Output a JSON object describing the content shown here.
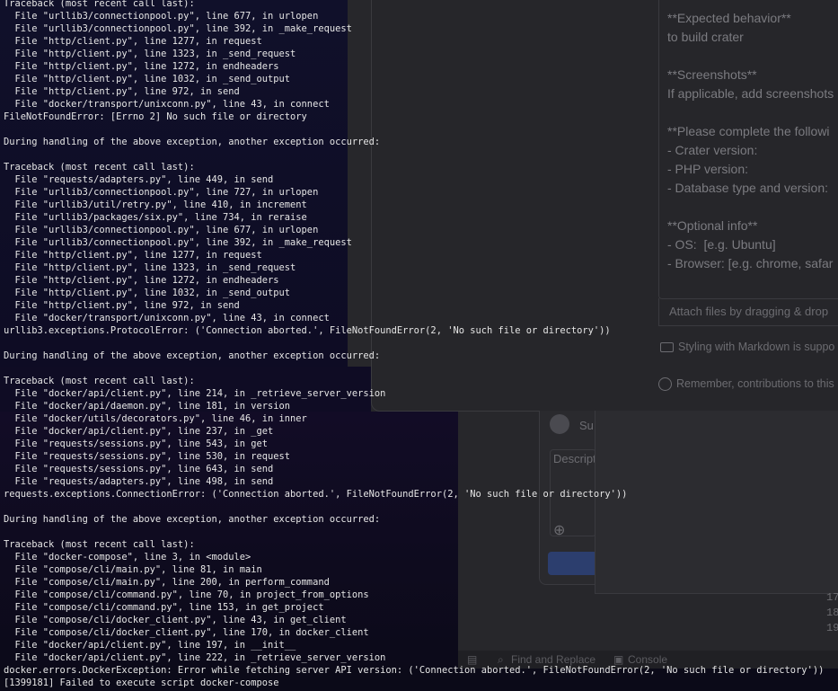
{
  "background": {
    "issue_body_lines": [
      "**Expected behavior**",
      "to build crater",
      "",
      "**Screenshots**",
      "If applicable, add screenshots",
      "",
      "**Please complete the followi",
      "- Crater version:",
      "- PHP version:",
      "- Database type and version:",
      "",
      "**Optional info**",
      "- OS:  [e.g. Ubuntu]",
      "- Browser: [e.g. chrome, safar"
    ],
    "attach_text": "Attach files by dragging & drop",
    "markdown_hint": "Styling with Markdown is suppo",
    "remember_text": "Remember, contributions to this",
    "card_text_1": "Su",
    "card_text_2": "Descript",
    "line_numbers": [
      "17",
      "18",
      "19"
    ],
    "devtools": {
      "find_replace": "Find and Replace",
      "console": "Console"
    }
  },
  "terminal": {
    "lines": [
      "Traceback (most recent call last):",
      "  File \"urllib3/connectionpool.py\", line 677, in urlopen",
      "  File \"urllib3/connectionpool.py\", line 392, in _make_request",
      "  File \"http/client.py\", line 1277, in request",
      "  File \"http/client.py\", line 1323, in _send_request",
      "  File \"http/client.py\", line 1272, in endheaders",
      "  File \"http/client.py\", line 1032, in _send_output",
      "  File \"http/client.py\", line 972, in send",
      "  File \"docker/transport/unixconn.py\", line 43, in connect",
      "FileNotFoundError: [Errno 2] No such file or directory",
      "",
      "During handling of the above exception, another exception occurred:",
      "",
      "Traceback (most recent call last):",
      "  File \"requests/adapters.py\", line 449, in send",
      "  File \"urllib3/connectionpool.py\", line 727, in urlopen",
      "  File \"urllib3/util/retry.py\", line 410, in increment",
      "  File \"urllib3/packages/six.py\", line 734, in reraise",
      "  File \"urllib3/connectionpool.py\", line 677, in urlopen",
      "  File \"urllib3/connectionpool.py\", line 392, in _make_request",
      "  File \"http/client.py\", line 1277, in request",
      "  File \"http/client.py\", line 1323, in _send_request",
      "  File \"http/client.py\", line 1272, in endheaders",
      "  File \"http/client.py\", line 1032, in _send_output",
      "  File \"http/client.py\", line 972, in send",
      "  File \"docker/transport/unixconn.py\", line 43, in connect",
      "urllib3.exceptions.ProtocolError: ('Connection aborted.', FileNotFoundError(2, 'No such file or directory'))",
      "",
      "During handling of the above exception, another exception occurred:",
      "",
      "Traceback (most recent call last):",
      "  File \"docker/api/client.py\", line 214, in _retrieve_server_version",
      "  File \"docker/api/daemon.py\", line 181, in version",
      "  File \"docker/utils/decorators.py\", line 46, in inner",
      "  File \"docker/api/client.py\", line 237, in _get",
      "  File \"requests/sessions.py\", line 543, in get",
      "  File \"requests/sessions.py\", line 530, in request",
      "  File \"requests/sessions.py\", line 643, in send",
      "  File \"requests/adapters.py\", line 498, in send",
      "requests.exceptions.ConnectionError: ('Connection aborted.', FileNotFoundError(2, 'No such file or directory'))",
      "",
      "During handling of the above exception, another exception occurred:",
      "",
      "Traceback (most recent call last):",
      "  File \"docker-compose\", line 3, in <module>",
      "  File \"compose/cli/main.py\", line 81, in main",
      "  File \"compose/cli/main.py\", line 200, in perform_command",
      "  File \"compose/cli/command.py\", line 70, in project_from_options",
      "  File \"compose/cli/command.py\", line 153, in get_project",
      "  File \"compose/cli/docker_client.py\", line 43, in get_client",
      "  File \"compose/cli/docker_client.py\", line 170, in docker_client",
      "  File \"docker/api/client.py\", line 197, in __init__",
      "  File \"docker/api/client.py\", line 222, in _retrieve_server_version",
      "docker.errors.DockerException: Error while fetching server API version: ('Connection aborted.', FileNotFoundError(2, 'No such file or directory'))",
      "[1399181] Failed to execute script docker-compose"
    ]
  }
}
